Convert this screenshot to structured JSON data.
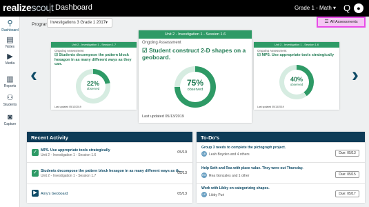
{
  "topbar": {
    "logo_a": "realize",
    "logo_b": "scout",
    "title": "Dashboard",
    "grade_menu": "Grade 1 - Math ▾",
    "search_glyph": "Q",
    "account_glyph": "●"
  },
  "sidebar": {
    "items": [
      {
        "label": "Dashboard",
        "icon": "telescope-icon",
        "glyph": "⚲"
      },
      {
        "label": "Notes",
        "icon": "notes-icon",
        "glyph": "▤"
      },
      {
        "label": "Media",
        "icon": "media-icon",
        "glyph": "▶"
      },
      {
        "label": "Reports",
        "icon": "reports-icon",
        "glyph": "▥"
      },
      {
        "label": "Students",
        "icon": "students-icon",
        "glyph": "⚇"
      },
      {
        "label": "Capture",
        "icon": "camera-icon",
        "glyph": "◙"
      }
    ]
  },
  "program": {
    "label": "Program",
    "selected": "Investigations 3 Grade 1 2017"
  },
  "all_assessments_label": "All Assessments",
  "cards": {
    "left": {
      "header": "Unit 2 - Investigation 1 - Session 1.7",
      "type": "Ongoing Assessment",
      "title": "Students decompose the pattern block hexagon in as many different ways as they can.",
      "percent": "22%",
      "percent_value": 22,
      "observed": "observed",
      "updated": "Last updated 05/13/2019"
    },
    "center": {
      "header": "Unit 2 - Investigation 1 - Session 1.6",
      "type": "Ongoing Assessment",
      "title": "Student construct 2-D shapes on a geoboard.",
      "percent": "75%",
      "percent_value": 75,
      "observed": "observed",
      "updated": "Last updated 05/13/2019"
    },
    "right": {
      "header": "Unit 2 - Investigation 1 - Session 1.6",
      "type": "Ongoing Assessment",
      "title": "MP5. Use appropriate tools strategically",
      "percent": "40%",
      "percent_value": 40,
      "observed": "observed",
      "updated": "Last updated 05/13/2019"
    }
  },
  "arrows": {
    "left": "‹",
    "right": "›"
  },
  "recent": {
    "title": "Recent Activity",
    "items": [
      {
        "title": "MP5. Use appropriate tools strategically",
        "sub": "Unit 2 - Investigation 1 - Session 1.6",
        "date": "05/10",
        "icon": "checkbox-icon"
      },
      {
        "title": "Students decompose the pattern block hexagon in as many different ways as th...",
        "sub": "Unit 2 - Investigation 1 - Session 1.7",
        "date": "05/13",
        "icon": "checkbox-icon"
      },
      {
        "title": "Amy's Geoboard",
        "sub": "",
        "date": "05/13",
        "icon": "media-icon"
      }
    ]
  },
  "todo": {
    "title": "To-Do's",
    "items": [
      {
        "title": "Group 3 needs to complete the pictograph project.",
        "who": "Leah Boyden and 4 others",
        "initials": "LB",
        "due": "Due: 05/13"
      },
      {
        "title": "Help Seth and Rea with place value. They were out Thursday.",
        "who": "Rea Gonzales and 1 other",
        "initials": "RG",
        "due": "Due: 05/15"
      },
      {
        "title": "Work with Libby on categorizing shapes.",
        "who": "Libby Puri",
        "initials": "LP",
        "due": "Due: 05/17"
      }
    ]
  },
  "colors": {
    "green": "#2e9a66",
    "navy": "#0d3b57",
    "ring_track": "#d6ece1",
    "highlight": "#f4c6f3"
  }
}
